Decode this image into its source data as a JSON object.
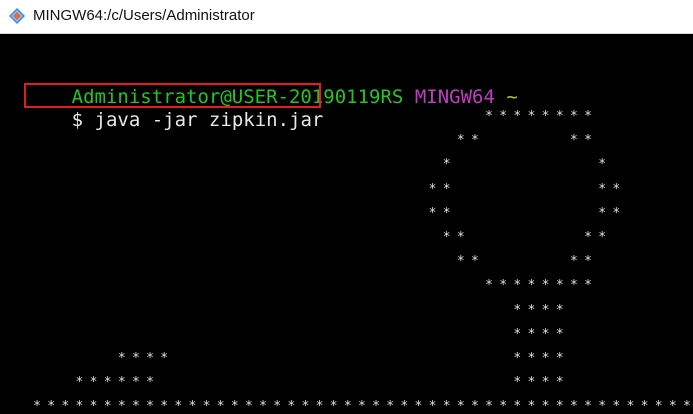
{
  "window": {
    "title": "MINGW64:/c/Users/Administrator"
  },
  "prompt": {
    "user_host": "Administrator@USER-20190119RS",
    "shell": "MINGW64",
    "path": "~",
    "symbol": "$",
    "command": "java -jar zipkin.jar"
  },
  "art_lines": [
    "                                 ********",
    "                               **      **",
    "                              *          *",
    "                             **          **",
    "                             **          **",
    "                              **        **",
    "                               **      **",
    "                                 ********",
    "                                   ****",
    "                                   ****",
    "       ****                        ****",
    "    ******                         ****",
    " ***********************************************"
  ],
  "colors": {
    "background": "#000000",
    "user_host": "#20c720",
    "shell": "#c23cc2",
    "path": "#c7c41d",
    "text": "#e8e8e8",
    "highlight_box": "#e31c1c"
  }
}
